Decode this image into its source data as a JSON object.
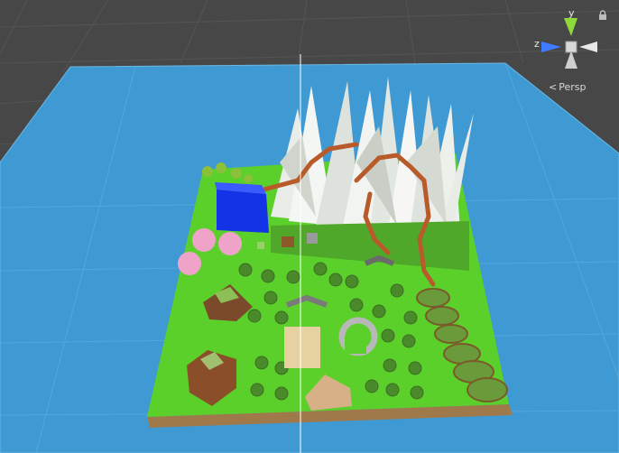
{
  "view": {
    "projection_label": "Persp",
    "projection_icon": "chevron-left-icon"
  },
  "gizmo": {
    "y_label": "y",
    "z_label": "z",
    "y_color": "#8ed83a",
    "z_color": "#3f7bff",
    "x_color": "#e8e8e8"
  },
  "scene": {
    "background_color": "#474747",
    "water_color": "#3f9ad3",
    "grass_color": "#5bd02b",
    "objects": [
      "terrain-island",
      "snow-mountains",
      "wooden-bridges",
      "blue-water-cube",
      "pink-blossom-trees",
      "green-bush-trees",
      "brown-rock-mounds",
      "stone-arch-ring",
      "sand-tiles",
      "stacked-cliff-steps",
      "palm-trees",
      "vertical-guide-line"
    ]
  },
  "lock_icon": "lock-icon"
}
